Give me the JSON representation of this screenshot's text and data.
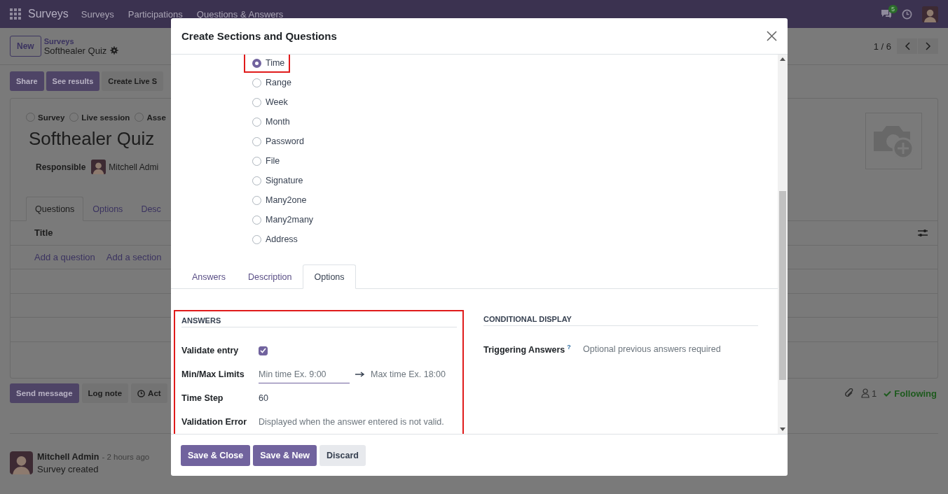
{
  "navbar": {
    "app_name": "Surveys",
    "menu": [
      "Surveys",
      "Participations",
      "Questions & Answers"
    ],
    "chat_badge": "5"
  },
  "control_panel": {
    "new_button": "New",
    "breadcrumb": "Surveys",
    "record": "Softhealer Quiz",
    "pager": "1 / 6"
  },
  "actions": [
    {
      "label": "Share",
      "kind": "primary"
    },
    {
      "label": "See results",
      "kind": "primary"
    },
    {
      "label": "Create Live S",
      "kind": "secondary"
    }
  ],
  "sheet": {
    "types": [
      {
        "label": "Survey",
        "selected": false
      },
      {
        "label": "Live session",
        "selected": false
      },
      {
        "label": "Asse",
        "selected": false
      }
    ],
    "title": "Softhealer Quiz",
    "responsible_label": "Responsible",
    "responsible": "Mitchell Admi",
    "tabs": [
      {
        "label": "Questions",
        "selected": true
      },
      {
        "label": "Options",
        "selected": false
      },
      {
        "label": "Desc",
        "selected": false
      }
    ],
    "table": {
      "columns": [
        "Title"
      ],
      "add_links": [
        "Add a question",
        "Add a section"
      ]
    }
  },
  "chatter": {
    "buttons": [
      {
        "label": "Send message",
        "kind": "primary"
      },
      {
        "label": "Log note",
        "kind": "secondary"
      },
      {
        "label": "Act",
        "kind": "activity"
      }
    ],
    "followers": "1",
    "following": "Following",
    "messages": [
      {
        "author": "Mitchell Admin",
        "time": "- 2 hours ago",
        "body": "Survey created"
      }
    ]
  },
  "dialog": {
    "title": "Create Sections and Questions",
    "question_types": [
      {
        "label": "Time",
        "selected": true
      },
      {
        "label": "Range",
        "selected": false
      },
      {
        "label": "Week",
        "selected": false
      },
      {
        "label": "Month",
        "selected": false
      },
      {
        "label": "Password",
        "selected": false
      },
      {
        "label": "File",
        "selected": false
      },
      {
        "label": "Signature",
        "selected": false
      },
      {
        "label": "Many2one",
        "selected": false
      },
      {
        "label": "Many2many",
        "selected": false
      },
      {
        "label": "Address",
        "selected": false
      }
    ],
    "tabs": [
      {
        "label": "Answers",
        "selected": false
      },
      {
        "label": "Description",
        "selected": false
      },
      {
        "label": "Options",
        "selected": true
      }
    ],
    "answers_section": {
      "heading": "ANSWERS",
      "validate_entry": {
        "label": "Validate entry",
        "checked": true
      },
      "min_max": {
        "label": "Min/Max Limits",
        "min_placeholder": "Min time Ex. 9:00",
        "max_placeholder": "Max time Ex. 18:00"
      },
      "time_step": {
        "label": "Time Step",
        "value": "60"
      },
      "validation_error": {
        "label": "Validation Error",
        "placeholder": "Displayed when the answer entered is not valid."
      }
    },
    "conditional_section": {
      "heading": "CONDITIONAL DISPLAY",
      "triggering": {
        "label": "Triggering Answers",
        "help": "?",
        "placeholder": "Optional previous answers required"
      }
    },
    "buttons": [
      {
        "label": "Save & Close",
        "kind": "primary"
      },
      {
        "label": "Save & New",
        "kind": "primary"
      },
      {
        "label": "Discard",
        "kind": "secondary"
      }
    ]
  }
}
